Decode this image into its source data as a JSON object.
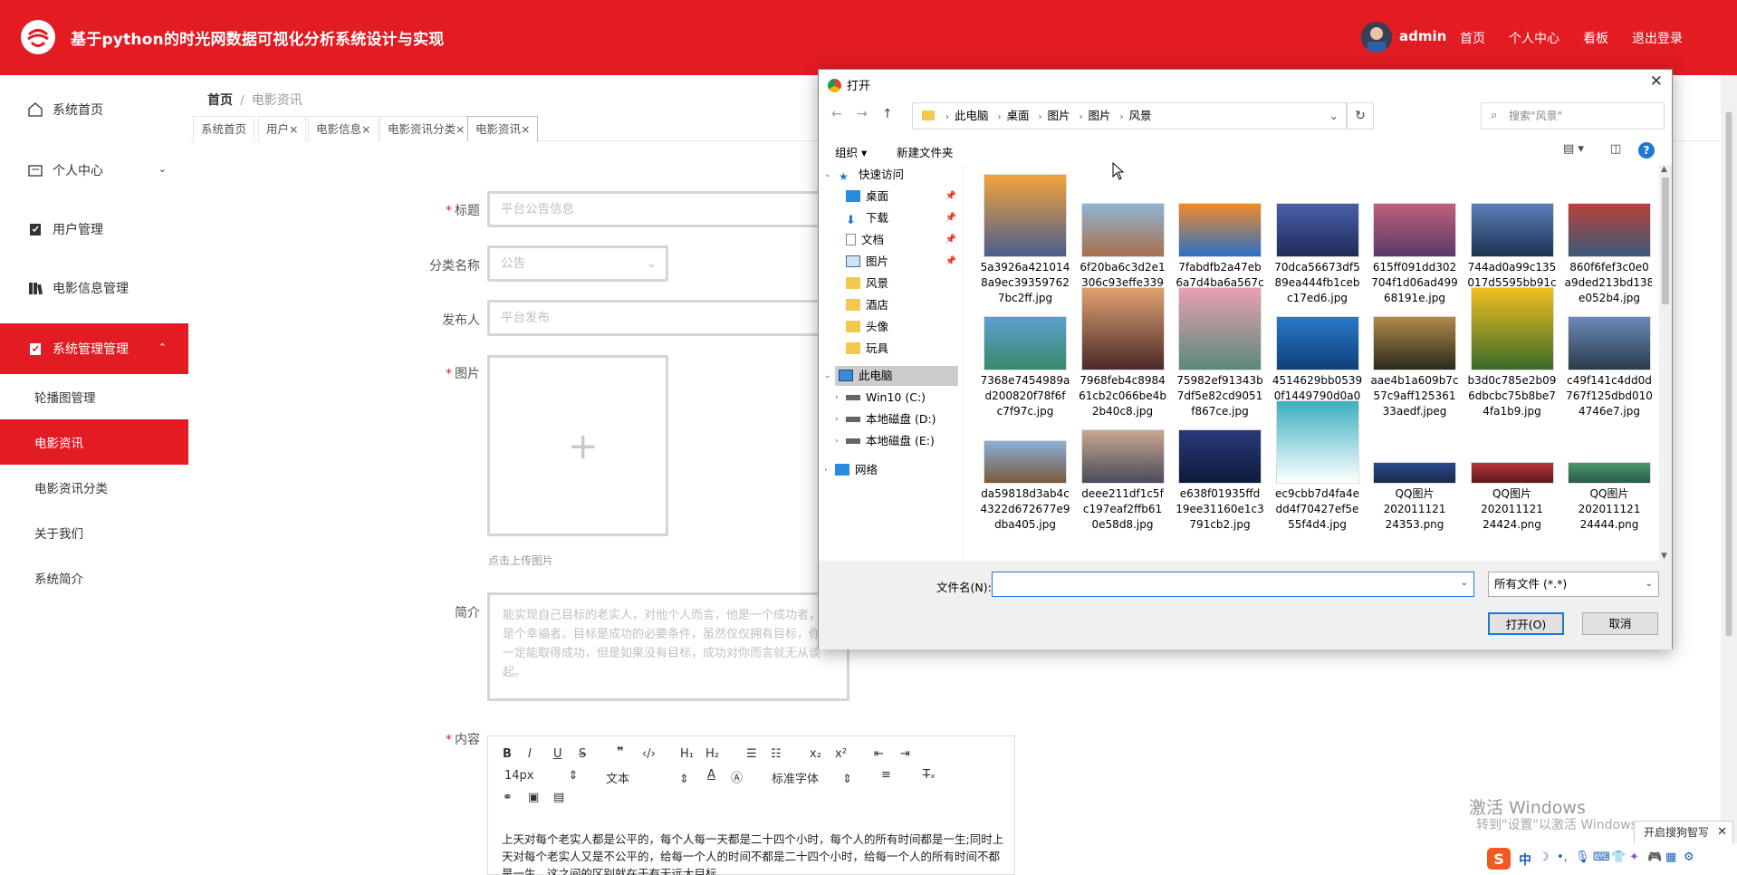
{
  "app": {
    "title": "基于python的时光网数据可视化分析系统设计与实现",
    "user": "admin",
    "nav": [
      "首页",
      "个人中心",
      "看板",
      "退出登录"
    ]
  },
  "sidebar": {
    "items": [
      {
        "label": "系统首页",
        "icon": "home-icon"
      },
      {
        "label": "个人中心",
        "icon": "id-card-icon"
      },
      {
        "label": "用户管理",
        "icon": "user-manage-icon"
      },
      {
        "label": "电影信息管理",
        "icon": "film-icon"
      },
      {
        "label": "系统管理管理",
        "icon": "system-icon"
      }
    ],
    "subitems": [
      "轮播图管理",
      "电影资讯",
      "电影资讯分类",
      "关于我们",
      "系统简介"
    ]
  },
  "breadcrumb": {
    "home": "首页",
    "current": "电影资讯"
  },
  "tabs": [
    {
      "label": "系统首页"
    },
    {
      "label": "用户×"
    },
    {
      "label": "电影信息×"
    },
    {
      "label": "电影资讯分类×"
    },
    {
      "label": "电影资讯×"
    }
  ],
  "form": {
    "title_label": "标题",
    "title_placeholder": "平台公告信息",
    "category_label": "分类名称",
    "category_value": "公告",
    "publisher_label": "发布人",
    "publisher_placeholder": "平台发布",
    "image_label": "图片",
    "upload_tip": "点击上传图片",
    "intro_label": "简介",
    "intro_text": "能实现自己目标的老实人，对他个人而言，他是一个成功者，也是个幸福者。目标是成功的必要条件，虽然仅仅拥有目标，你不一定能取得成功，但是如果没有目标，成功对你而言就无从谈起。",
    "content_label": "内容",
    "editor": {
      "font_size": "14px",
      "block_type": "文本",
      "font_family": "标准字体",
      "content": "上天对每个老实人都是公平的，每个人每一天都是二十四个小时，每个人的所有时间都是一生;同时上天对每个老实人又是不公平的，给每一个人的时间不都是二十四个小时，给每一个人的所有时间不都是一生。这之间的区别就在于有无远大目标。"
    }
  },
  "dialog": {
    "title": "打开",
    "path": [
      "此电脑",
      "桌面",
      "图片",
      "图片",
      "风景"
    ],
    "search_placeholder": "搜索\"风景\"",
    "toolbar": {
      "organize": "组织 ▾",
      "new_folder": "新建文件夹"
    },
    "tree": {
      "quick_access": "快速访问",
      "quick_items": [
        "桌面",
        "下载",
        "文档",
        "图片",
        "风景",
        "酒店",
        "头像",
        "玩具"
      ],
      "this_pc": "此电脑",
      "drives": [
        "Win10 (C:)",
        "本地磁盘 (D:)",
        "本地磁盘 (E:)"
      ],
      "network": "网络"
    },
    "files": [
      {
        "name": "5a3926a4210148a9ec393597627bc2ff.jpg",
        "colors": [
          "#f3a33a",
          "#4a5e8e"
        ]
      },
      {
        "name": "6f20ba6c3d2e1306c93effe339edd4b6.jpeg",
        "colors": [
          "#8fb4d4",
          "#a86f4c"
        ]
      },
      {
        "name": "7fabdfb2a47eb6a7d4ba6a567c82d8fa.jpg",
        "colors": [
          "#f08a2a",
          "#2a70c8"
        ]
      },
      {
        "name": "70dca56673df589ea444fb1cebc17ed6.jpg",
        "colors": [
          "#4a5fa8",
          "#1e2b5a"
        ]
      },
      {
        "name": "615ff091dd302704f1d06ad49968191e.jpg",
        "colors": [
          "#c0607a",
          "#5a3a6a"
        ]
      },
      {
        "name": "744ad0a99c135017d5595bb91c22172.jpg",
        "colors": [
          "#5a7fb8",
          "#1d3352"
        ]
      },
      {
        "name": "860f6fef3c0e0a9ded213bd138e052b4.jpg",
        "colors": [
          "#b8413a",
          "#3a5a7a"
        ]
      },
      {
        "name": "7368e7454989ad200820f78f6fc7f97c.jpg",
        "colors": [
          "#5aa0d0",
          "#3a8a6a"
        ]
      },
      {
        "name": "7968feb4c898461cb2c066be4b2b40c8.jpg",
        "colors": [
          "#e0a070",
          "#4a2a2a"
        ]
      },
      {
        "name": "75982ef91343b7df5e82cd9051f867ce.jpg",
        "colors": [
          "#e8a0b0",
          "#5a8a7a"
        ]
      },
      {
        "name": "4514629bb05390f1449790d0a0d346c5.jpg",
        "colors": [
          "#2a7ac8",
          "#0e3f78"
        ]
      },
      {
        "name": "aae4b1a609b7c57c9aff12536133aedf.jpeg",
        "colors": [
          "#b08a4a",
          "#2a2a1a"
        ]
      },
      {
        "name": "b3d0c785e2b096dbcbc75b8be74fa1b9.jpg",
        "colors": [
          "#f0c020",
          "#3a6a2a"
        ]
      },
      {
        "name": "c49f141c4dd0d767f125dbd0104746e7.jpg",
        "colors": [
          "#6a8ab8",
          "#2a3a4a"
        ]
      },
      {
        "name": "da59818d3ab4c4322d672677e9dba405.jpg",
        "colors": [
          "#8ab0d8",
          "#7a5a3a"
        ]
      },
      {
        "name": "deee211df1c5fc197eaf2ffb610e58d8.jpg",
        "colors": [
          "#c8a890",
          "#4a4a5a"
        ]
      },
      {
        "name": "e638f01935ffd19ee31160e1c3791cb2.jpg",
        "colors": [
          "#2a3a7a",
          "#0e1a3a"
        ]
      },
      {
        "name": "ec9cbb7d4fa4edd4f70427ef5e55f4d4.jpg",
        "colors": [
          "#3ab0c0",
          "#ffffff"
        ]
      },
      {
        "name": "QQ图片20201112124353.png",
        "colors": [
          "#2a4a8a",
          "#1a2a4a"
        ]
      },
      {
        "name": "QQ图片20201112124424.png",
        "colors": [
          "#b8343a",
          "#5a1a1a"
        ]
      },
      {
        "name": "QQ图片20201112124444.png",
        "colors": [
          "#4a9a6a",
          "#2a5a4a"
        ]
      }
    ],
    "filename_label": "文件名(N):",
    "filetype": "所有文件 (*.*)",
    "open_button": "打开(O)",
    "cancel_button": "取消"
  },
  "watermark": {
    "line1": "激活 Windows",
    "line2": "转到\"设置\"以激活 Windows。"
  },
  "ime_tip": "开启搜狗智写"
}
